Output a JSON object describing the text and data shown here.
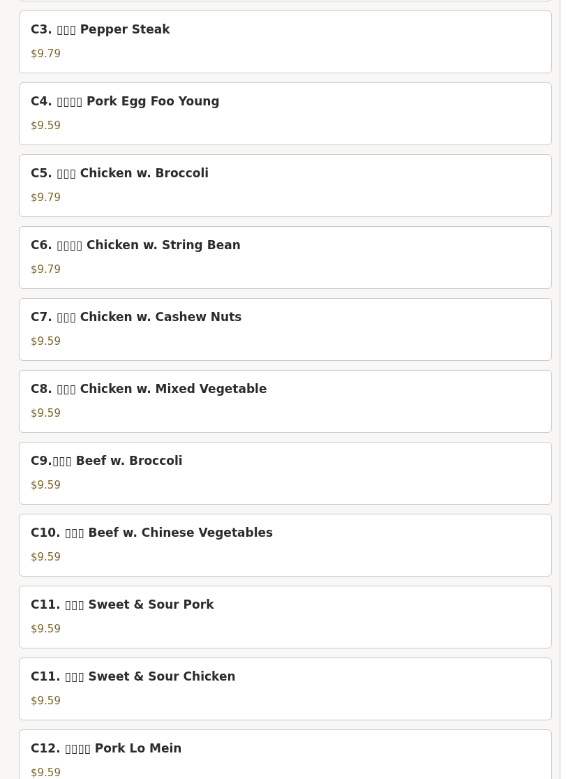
{
  "menu_items": [
    {
      "title": "C3. ▯▯▯ Pepper Steak",
      "price": "$9.79"
    },
    {
      "title": "C4. ▯▯▯▯ Pork Egg Foo Young",
      "price": "$9.59"
    },
    {
      "title": "C5. ▯▯▯ Chicken w. Broccoli",
      "price": "$9.79"
    },
    {
      "title": "C6. ▯▯▯▯ Chicken w. String Bean",
      "price": "$9.79"
    },
    {
      "title": "C7. ▯▯▯ Chicken w. Cashew Nuts",
      "price": "$9.59"
    },
    {
      "title": "C8. ▯▯▯ Chicken w. Mixed Vegetable",
      "price": "$9.59"
    },
    {
      "title": "C9.▯▯▯ Beef w. Broccoli",
      "price": "$9.59"
    },
    {
      "title": "C10. ▯▯▯ Beef w. Chinese Vegetables",
      "price": "$9.59"
    },
    {
      "title": "C11. ▯▯▯ Sweet & Sour Pork",
      "price": "$9.59"
    },
    {
      "title": "C11. ▯▯▯ Sweet & Sour Chicken",
      "price": "$9.59"
    },
    {
      "title": "C12. ▯▯▯▯ Pork Lo Mein",
      "price": "$9.59"
    }
  ]
}
